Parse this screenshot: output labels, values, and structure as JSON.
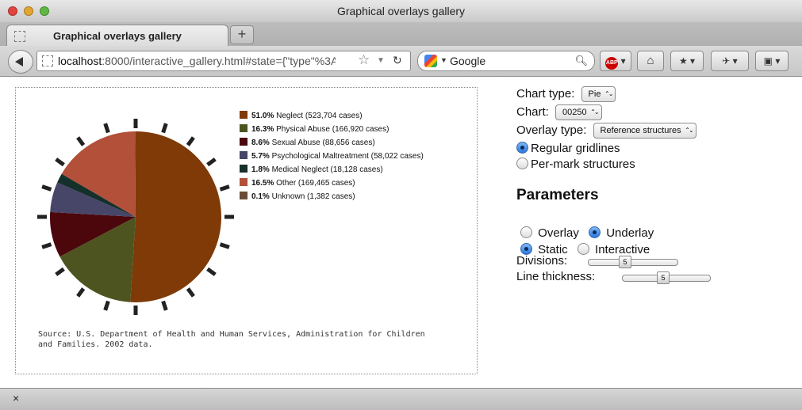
{
  "window": {
    "title": "Graphical overlays gallery"
  },
  "tabs": [
    {
      "label": "Graphical overlays gallery"
    }
  ],
  "newtab_label": "+",
  "address": {
    "host": "localhost",
    "rest": ":8000/interactive_gallery.html#state={\"type\"%3A"
  },
  "search": {
    "engine": "Google"
  },
  "toolbar": {
    "abp_label": "ABP"
  },
  "statusbar": {
    "close_label": "×"
  },
  "chart_data": {
    "type": "pie",
    "slices": [
      {
        "pct_label": "51.0%",
        "label": "Neglect (523,704 cases)",
        "value": 51.0,
        "color": "#7f3a07"
      },
      {
        "pct_label": "16.3%",
        "label": "Physical Abuse (166,920 cases)",
        "value": 16.3,
        "color": "#4e5420"
      },
      {
        "pct_label": "8.6%",
        "label": "Sexual Abuse (88,656 cases)",
        "value": 8.6,
        "color": "#4b070c"
      },
      {
        "pct_label": "5.7%",
        "label": "Psychological Maltreatment (58,022 cases)",
        "value": 5.7,
        "color": "#474668"
      },
      {
        "pct_label": "1.8%",
        "label": "Medical Neglect (18,128 cases)",
        "value": 1.8,
        "color": "#15302b"
      },
      {
        "pct_label": "16.5%",
        "label": "Other (169,465 cases)",
        "value": 16.5,
        "color": "#b2503a"
      },
      {
        "pct_label": "0.1%",
        "label": "Unknown (1,382 cases)",
        "value": 0.1,
        "color": "#6b4c37"
      }
    ],
    "overlay": {
      "type": "reference gridlines",
      "divisions": 5
    },
    "source": "Source: U.S. Department of Health and Human Services, Administration for Children and Families. 2002 data."
  },
  "panel": {
    "chart_type_label": "Chart type:",
    "chart_type_value": "Pie",
    "chart_label": "Chart:",
    "chart_value": "00250",
    "overlay_type_label": "Overlay type:",
    "overlay_type_value": "Reference structures",
    "radio_gridlines": "Regular gridlines",
    "radio_permark": "Per-mark structures",
    "parameters_heading": "Parameters",
    "radio_overlay": "Overlay",
    "radio_underlay": "Underlay",
    "radio_static": "Static",
    "radio_interactive": "Interactive",
    "divisions_label": "Divisions:",
    "divisions_value": "5",
    "thickness_label": "Line thickness:",
    "thickness_value": "5"
  }
}
